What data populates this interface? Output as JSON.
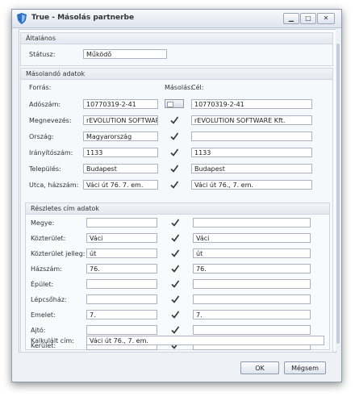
{
  "window": {
    "title": "True - Másolás partnerbe",
    "minimize": "▁",
    "maximize": "□",
    "close": "✕"
  },
  "general": {
    "header": "Általános",
    "status_label": "Státusz:",
    "status_value": "Működő"
  },
  "copy": {
    "header": "Másolandó adatok",
    "source_label": "Forrás:",
    "copy_label": "Másolás:",
    "target_label": "Cél:",
    "rows": [
      {
        "label": "Adószám:",
        "source": "10770319-2-41",
        "target": "10770319-2-41",
        "checked": false
      },
      {
        "label": "Megnevezés:",
        "source": "rEVOLUTION SOFTWARE Kft.",
        "target": "rEVOLUTION SOFTWARE Kft.",
        "checked": true
      },
      {
        "label": "Ország:",
        "source": "Magyarország",
        "target": "",
        "checked": true
      },
      {
        "label": "Irányítószám:",
        "source": "1133",
        "target": "1133",
        "checked": true
      },
      {
        "label": "Település:",
        "source": "Budapest",
        "target": "Budapest",
        "checked": true
      },
      {
        "label": "Utca, házszám:",
        "source": "Váci út 76. 7. em.",
        "target": "Váci út 76., 7. em.",
        "checked": true
      }
    ]
  },
  "detail": {
    "header": "Részletes cím adatok",
    "rows": [
      {
        "label": "Megye:",
        "source": "",
        "target": "",
        "checked": true
      },
      {
        "label": "Közterület:",
        "source": "Váci",
        "target": "Váci",
        "checked": true
      },
      {
        "label": "Közterület jelleg:",
        "source": "út",
        "target": "út",
        "checked": true
      },
      {
        "label": "Házszám:",
        "source": "76.",
        "target": "76.",
        "checked": true
      },
      {
        "label": "Épület:",
        "source": "",
        "target": "",
        "checked": true
      },
      {
        "label": "Lépcsőház:",
        "source": "",
        "target": "",
        "checked": true
      },
      {
        "label": "Emelet:",
        "source": "7.",
        "target": "7.",
        "checked": true
      },
      {
        "label": "Ajtó:",
        "source": "",
        "target": "",
        "checked": true
      },
      {
        "label": "Kerület:",
        "source": "",
        "target": "",
        "checked": true
      }
    ],
    "calc_label": "Kalkulált cím:",
    "calc_value": "Váci út 76., 7. em."
  },
  "buttons": {
    "ok": "OK",
    "cancel": "Mégsem"
  }
}
